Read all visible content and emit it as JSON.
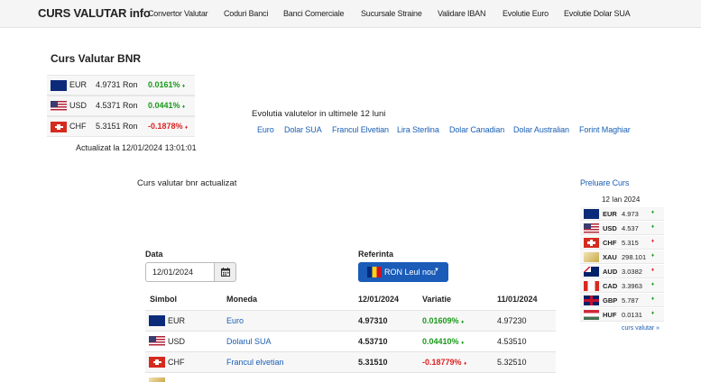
{
  "nav": {
    "brand": "CURS VALUTAR info",
    "links": [
      "Convertor Valutar",
      "Coduri Banci",
      "Banci Comerciale",
      "Sucursale Straine",
      "Validare IBAN",
      "Evolutie Euro",
      "Evolutie Dolar SUA"
    ]
  },
  "bnr_widget": {
    "title": "Curs Valutar BNR",
    "rows": [
      {
        "code": "EUR",
        "value": "4.9731 Ron",
        "change": "0.0161%",
        "arrow": "♦",
        "direction": "up",
        "flag": "eu-flag-icon"
      },
      {
        "code": "USD",
        "value": "4.5371 Ron",
        "change": "0.0441%",
        "arrow": "♦",
        "direction": "up",
        "flag": "us-flag-icon"
      },
      {
        "code": "CHF",
        "value": "5.3151 Ron",
        "change": "-0.1878%",
        "arrow": "♦",
        "direction": "down",
        "flag": "ch-flag-icon"
      }
    ],
    "updated": "Actualizat la 12/01/2024 13:01:01"
  },
  "evolution": {
    "title": "Evolutia valutelor in ultimele 12 luni",
    "links": [
      "Euro",
      "Dolar SUA",
      "Francul Elvetian",
      "Lira Sterlina",
      "Dolar Canadian",
      "Dolar Australian",
      "Forint Maghiar"
    ]
  },
  "main_heading": "Curs valutar bnr actualizat",
  "form": {
    "date_label": "Data",
    "date_value": "12/01/2024",
    "ref_label": "Referinta",
    "ref_value": "RON Leul nou"
  },
  "table": {
    "headers": [
      "Simbol",
      "Moneda",
      "12/01/2024",
      "Variatie",
      "11/01/2024"
    ],
    "rows": [
      {
        "code": "EUR",
        "name": "Euro",
        "today": "4.97310",
        "change": "0.01609%",
        "direction": "up",
        "yesterday": "4.97230",
        "flag": "eu-flag-icon"
      },
      {
        "code": "USD",
        "name": "Dolarul SUA",
        "today": "4.53710",
        "change": "0.04410%",
        "direction": "up",
        "yesterday": "4.53510",
        "flag": "us-flag-icon"
      },
      {
        "code": "CHF",
        "name": "Francul elvetian",
        "today": "5.31510",
        "change": "-0.18779%",
        "direction": "down",
        "yesterday": "5.32510",
        "flag": "ch-flag-icon"
      }
    ]
  },
  "side_widget": {
    "title": "Preluare Curs",
    "date": "12 Ian 2024",
    "rows": [
      {
        "code": "EUR",
        "value": "4.973",
        "direction": "up",
        "flag": "eu-flag-icon"
      },
      {
        "code": "USD",
        "value": "4.537",
        "direction": "up",
        "flag": "us-flag-icon"
      },
      {
        "code": "CHF",
        "value": "5.315",
        "direction": "down",
        "flag": "ch-flag-icon"
      },
      {
        "code": "XAU",
        "value": "298.101",
        "direction": "up",
        "flag": "gold-icon"
      },
      {
        "code": "AUD",
        "value": "3.0382",
        "direction": "down",
        "flag": "au-flag-icon"
      },
      {
        "code": "CAD",
        "value": "3.3963",
        "direction": "up",
        "flag": "ca-flag-icon"
      },
      {
        "code": "GBP",
        "value": "5.787",
        "direction": "up",
        "flag": "gb-flag-icon"
      },
      {
        "code": "HUF",
        "value": "0.0131",
        "direction": "up",
        "flag": "hu-flag-icon"
      }
    ],
    "arrow": "♦",
    "more_link": "curs valutar »"
  },
  "colors": {
    "up": "#1a9a1a",
    "down": "#dd2222",
    "link": "#1a5fb4",
    "button": "#1a5cb8"
  }
}
